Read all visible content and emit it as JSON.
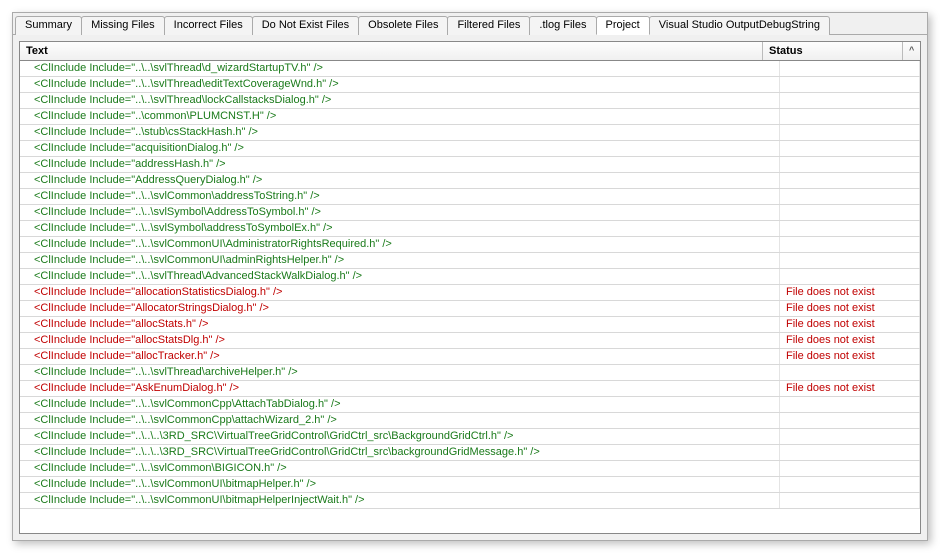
{
  "tabs": [
    {
      "label": "Summary"
    },
    {
      "label": "Missing Files"
    },
    {
      "label": "Incorrect Files"
    },
    {
      "label": "Do Not Exist Files"
    },
    {
      "label": "Obsolete Files"
    },
    {
      "label": "Filtered Files"
    },
    {
      "label": ".tlog Files"
    },
    {
      "label": "Project"
    },
    {
      "label": "Visual Studio OutputDebugString"
    }
  ],
  "activeTabIndex": 7,
  "columns": {
    "text": "Text",
    "status": "Status"
  },
  "scrollHeader": "^",
  "rows": [
    {
      "text": "<ClInclude Include=\"..\\..\\svlThread\\d_wizardStartupTV.h\" />",
      "status": "",
      "color": "green"
    },
    {
      "text": "<ClInclude Include=\"..\\..\\svlThread\\editTextCoverageWnd.h\" />",
      "status": "",
      "color": "green"
    },
    {
      "text": "<ClInclude Include=\"..\\..\\svlThread\\lockCallstacksDialog.h\" />",
      "status": "",
      "color": "green"
    },
    {
      "text": "<ClInclude Include=\"..\\common\\PLUMCNST.H\" />",
      "status": "",
      "color": "green"
    },
    {
      "text": "<ClInclude Include=\"..\\stub\\csStackHash.h\" />",
      "status": "",
      "color": "green"
    },
    {
      "text": "<ClInclude Include=\"acquisitionDialog.h\" />",
      "status": "",
      "color": "green"
    },
    {
      "text": "<ClInclude Include=\"addressHash.h\" />",
      "status": "",
      "color": "green"
    },
    {
      "text": "<ClInclude Include=\"AddressQueryDialog.h\" />",
      "status": "",
      "color": "green"
    },
    {
      "text": "<ClInclude Include=\"..\\..\\svlCommon\\addressToString.h\" />",
      "status": "",
      "color": "green"
    },
    {
      "text": "<ClInclude Include=\"..\\..\\svlSymbol\\AddressToSymbol.h\" />",
      "status": "",
      "color": "green"
    },
    {
      "text": "<ClInclude Include=\"..\\..\\svlSymbol\\addressToSymbolEx.h\" />",
      "status": "",
      "color": "green"
    },
    {
      "text": "<ClInclude Include=\"..\\..\\svlCommonUI\\AdministratorRightsRequired.h\" />",
      "status": "",
      "color": "green"
    },
    {
      "text": "<ClInclude Include=\"..\\..\\svlCommonUI\\adminRightsHelper.h\" />",
      "status": "",
      "color": "green"
    },
    {
      "text": "<ClInclude Include=\"..\\..\\svlThread\\AdvancedStackWalkDialog.h\" />",
      "status": "",
      "color": "green"
    },
    {
      "text": "<ClInclude Include=\"allocationStatisticsDialog.h\" />",
      "status": "File does not exist",
      "color": "red"
    },
    {
      "text": "<ClInclude Include=\"AllocatorStringsDialog.h\" />",
      "status": "File does not exist",
      "color": "red"
    },
    {
      "text": "<ClInclude Include=\"allocStats.h\" />",
      "status": "File does not exist",
      "color": "red"
    },
    {
      "text": "<ClInclude Include=\"allocStatsDlg.h\" />",
      "status": "File does not exist",
      "color": "red"
    },
    {
      "text": "<ClInclude Include=\"allocTracker.h\" />",
      "status": "File does not exist",
      "color": "red"
    },
    {
      "text": "<ClInclude Include=\"..\\..\\svlThread\\archiveHelper.h\" />",
      "status": "",
      "color": "green"
    },
    {
      "text": "<ClInclude Include=\"AskEnumDialog.h\" />",
      "status": "File does not exist",
      "color": "red"
    },
    {
      "text": "<ClInclude Include=\"..\\..\\svlCommonCpp\\AttachTabDialog.h\" />",
      "status": "",
      "color": "green"
    },
    {
      "text": "<ClInclude Include=\"..\\..\\svlCommonCpp\\attachWizard_2.h\" />",
      "status": "",
      "color": "green"
    },
    {
      "text": "<ClInclude Include=\"..\\..\\..\\3RD_SRC\\VirtualTreeGridControl\\GridCtrl_src\\BackgroundGridCtrl.h\" />",
      "status": "",
      "color": "green"
    },
    {
      "text": "<ClInclude Include=\"..\\..\\..\\3RD_SRC\\VirtualTreeGridControl\\GridCtrl_src\\backgroundGridMessage.h\" />",
      "status": "",
      "color": "green"
    },
    {
      "text": "<ClInclude Include=\"..\\..\\svlCommon\\BIGICON.h\" />",
      "status": "",
      "color": "green"
    },
    {
      "text": "<ClInclude Include=\"..\\..\\svlCommonUI\\bitmapHelper.h\" />",
      "status": "",
      "color": "green"
    },
    {
      "text": "<ClInclude Include=\"..\\..\\svlCommonUI\\bitmapHelperInjectWait.h\" />",
      "status": "",
      "color": "green"
    }
  ]
}
